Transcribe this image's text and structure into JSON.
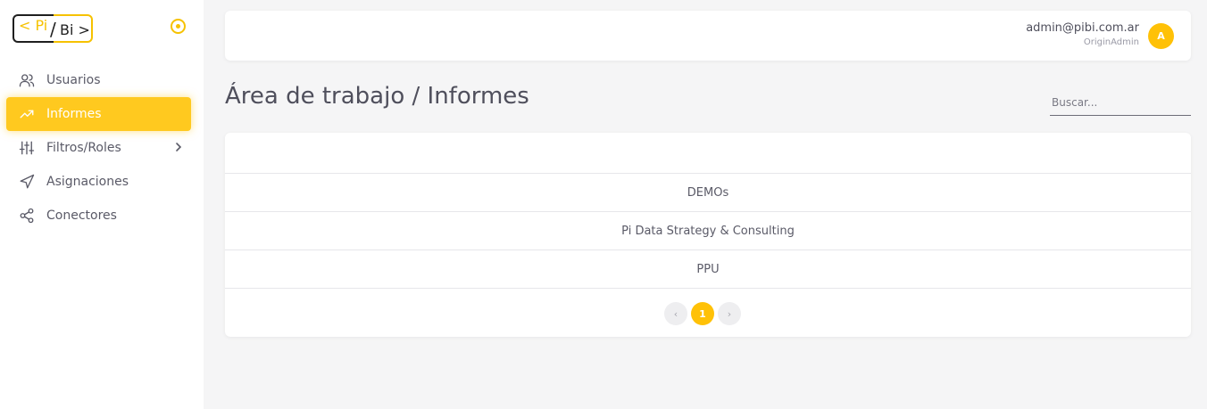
{
  "sidebar": {
    "logo": {
      "left": "< Pi",
      "slash": "/",
      "right": "Bi >"
    },
    "items": [
      {
        "label": "Usuarios",
        "icon": "users-icon"
      },
      {
        "label": "Informes",
        "icon": "trending-up-icon",
        "active": true
      },
      {
        "label": "Filtros/Roles",
        "icon": "sliders-icon",
        "has_submenu": true
      },
      {
        "label": "Asignaciones",
        "icon": "send-icon"
      },
      {
        "label": "Conectores",
        "icon": "share-icon"
      }
    ]
  },
  "header": {
    "user_email": "admin@pibi.com.ar",
    "user_role": "OriginAdmin",
    "avatar_initial": "A"
  },
  "main": {
    "title": "Área de trabajo / Informes",
    "search_placeholder": "Buscar..."
  },
  "table": {
    "rows": [
      "DEMOs",
      "Pi Data Strategy & Consulting",
      "PPU"
    ]
  },
  "pagination": {
    "prev": "‹",
    "current": "1",
    "next": "›"
  },
  "colors": {
    "accent": "#ffc107",
    "active_menu": "#ffc91f",
    "text": "#5a5a67",
    "background": "#f5f5f6"
  }
}
